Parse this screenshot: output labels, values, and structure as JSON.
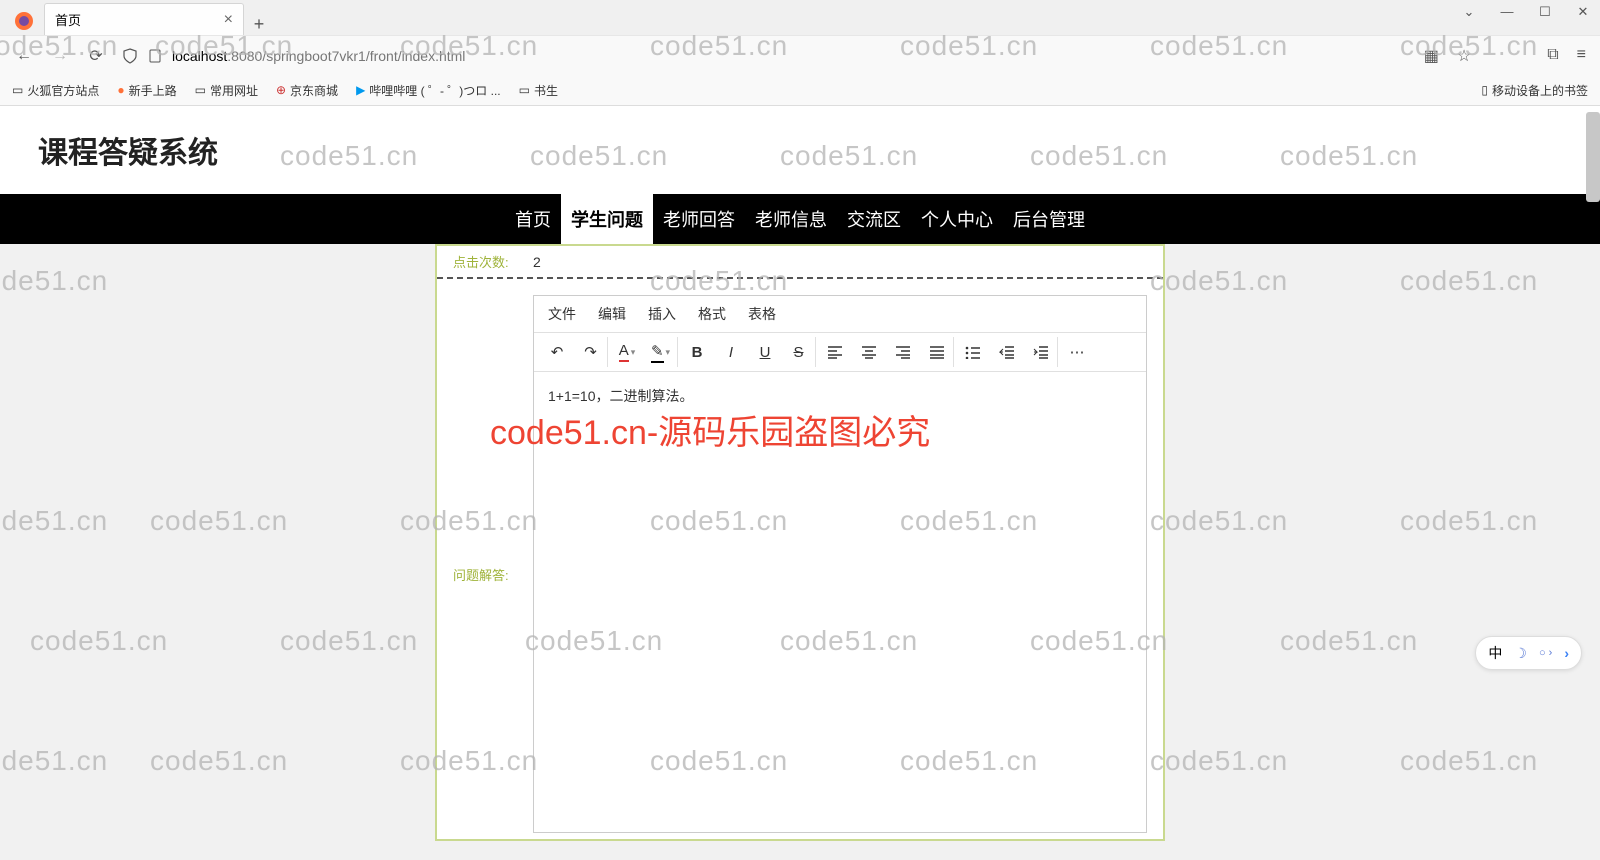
{
  "browser": {
    "tab_title": "首页",
    "url_host": "localhost",
    "url_port": ":8080",
    "url_path": "/springboot7vkr1/front/index.html",
    "bookmarks": [
      "火狐官方站点",
      "新手上路",
      "常用网址",
      "京东商城",
      "哔哩哔哩 ( ゜- ゜)つロ ...",
      "书生"
    ],
    "bookmark_right": "移动设备上的书签"
  },
  "page": {
    "title": "课程答疑系统",
    "nav": [
      "首页",
      "学生问题",
      "老师回答",
      "老师信息",
      "交流区",
      "个人中心",
      "后台管理"
    ],
    "nav_active_index": 1,
    "click_label": "点击次数:",
    "click_count": "2",
    "answer_label": "问题解答:"
  },
  "editor": {
    "menus": [
      "文件",
      "编辑",
      "插入",
      "格式",
      "表格"
    ],
    "body_text": "1+1=10，二进制算法。"
  },
  "watermark_text": "code51.cn",
  "watermark_red": "code51.cn-源码乐园盗图必究",
  "ime": {
    "lang": "中"
  }
}
